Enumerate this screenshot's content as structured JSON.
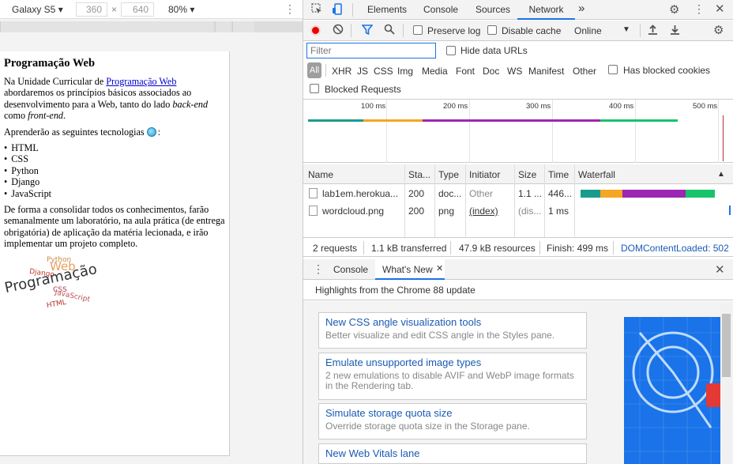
{
  "device_toolbar": {
    "device": "Galaxy S5",
    "width": "360",
    "times": "×",
    "height": "640",
    "zoom": "80%"
  },
  "page": {
    "title": "Programação Web",
    "p1_pre": "Na Unidade Curricular de ",
    "p1_link": "Programação Web",
    "p1_mid": " abordaremos os princípios básicos associados ao desenvolvimento para a Web, tanto do lado ",
    "p1_em1": "back-end",
    "p1_and": " como ",
    "p1_em2": "front-end",
    "p1_end": ".",
    "p2": "Aprenderão as seguintes tecnologias",
    "p2_colon": ":",
    "list": [
      "HTML",
      "CSS",
      "Python",
      "Django",
      "JavaScript"
    ],
    "p3": "De forma a consolidar todos os conhecimentos, farão semanalmente um laboratório, na aula prática (de entrega obrigatória) de aplicação da matéria lecionada, e irão implementar um projeto completo.",
    "wordcloud": {
      "w1": "Python",
      "w2": "Web",
      "w3": "Django",
      "w4": "Programação",
      "w5": "CSS",
      "w6": "JavaScript",
      "w7": "HTML"
    }
  },
  "devtools": {
    "tabs": [
      "Elements",
      "Console",
      "Sources",
      "Network"
    ],
    "more_tabs": "»",
    "toolbar": {
      "preserve_log": "Preserve log",
      "disable_cache": "Disable cache",
      "throttle": "Online"
    },
    "filter": {
      "placeholder": "Filter",
      "hide_data_urls": "Hide data URLs",
      "types": [
        "All",
        "XHR",
        "JS",
        "CSS",
        "Img",
        "Media",
        "Font",
        "Doc",
        "WS",
        "Manifest",
        "Other"
      ],
      "has_blocked_cookies": "Has blocked cookies",
      "blocked_requests": "Blocked Requests"
    },
    "overview_ticks": [
      "100 ms",
      "200 ms",
      "300 ms",
      "400 ms",
      "500 ms"
    ],
    "columns": [
      "Name",
      "Sta...",
      "Type",
      "Initiator",
      "Size",
      "Time",
      "Waterfall"
    ],
    "rows": [
      {
        "name": "lab1em.herokua...",
        "status": "200",
        "type": "doc...",
        "initiator": "Other",
        "size": "1.1 ...",
        "time": "446..."
      },
      {
        "name": "wordcloud.png",
        "status": "200",
        "type": "png",
        "initiator": "(index)",
        "size": "(dis...",
        "time": "1 ms"
      }
    ],
    "status": {
      "requests": "2 requests",
      "transferred": "1.1 kB transferred",
      "resources": "47.9 kB resources",
      "finish": "Finish: 499 ms",
      "dcl": "DOMContentLoaded: 502"
    },
    "drawer": {
      "tabs": [
        "Console",
        "What's New"
      ],
      "header": "Highlights from the Chrome 88 update",
      "cards": [
        {
          "title": "New CSS angle visualization tools",
          "desc": "Better visualize and edit CSS angle in the Styles pane."
        },
        {
          "title": "Emulate unsupported image types",
          "desc": "2 new emulations to disable AVIF and WebP image formats in the Rendering tab."
        },
        {
          "title": "Simulate storage quota size",
          "desc": "Override storage quota size in the Storage pane."
        },
        {
          "title": "New Web Vitals lane",
          "desc": ""
        }
      ]
    }
  },
  "colors": {
    "accent": "#1a73e8",
    "record": "#e00000",
    "wf_teal": "#1a9c8c",
    "wf_orange": "#f5a623",
    "wf_purple": "#9c27b0",
    "wf_green": "#17c46b"
  }
}
